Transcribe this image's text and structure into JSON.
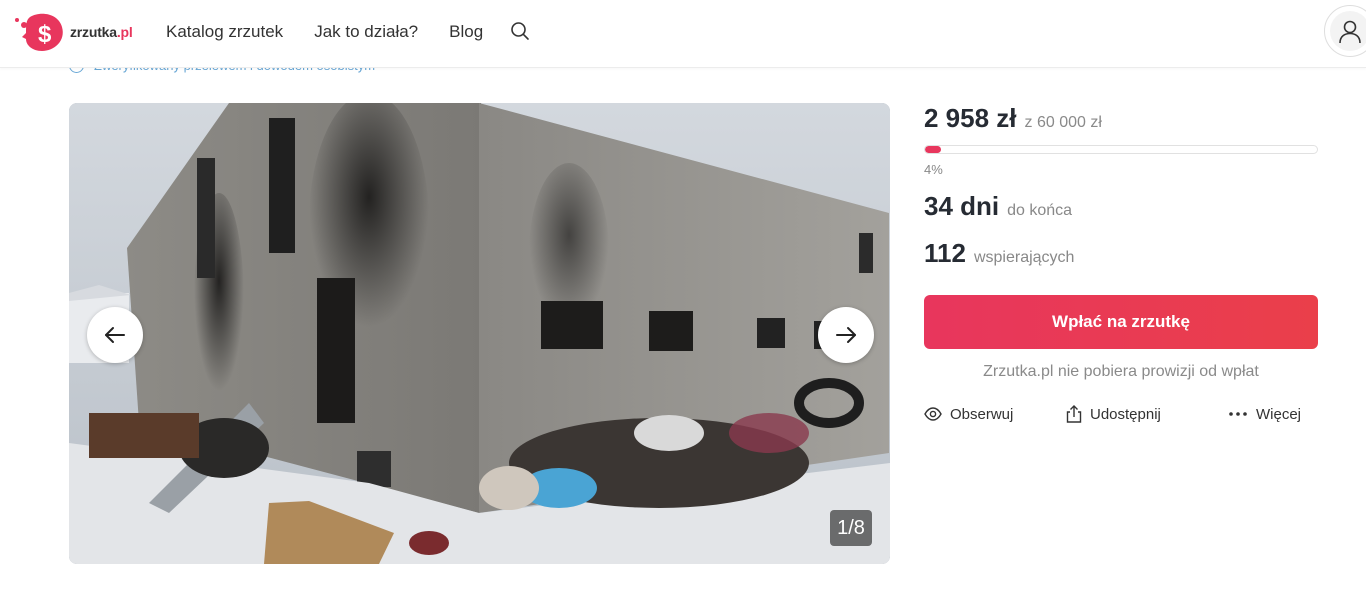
{
  "header": {
    "logo_text": "zrzutka",
    "logo_suffix": ".pl",
    "nav": [
      "Katalog zrzutek",
      "Jak to działa?",
      "Blog"
    ]
  },
  "verified_text": "Zweryfikowany przelewem i dowodem osobistym",
  "gallery": {
    "counter": "1/8",
    "current_index": 1,
    "total": 8
  },
  "funding": {
    "amount": "2 958 zł",
    "goal": "z 60 000 zł",
    "progress_percent": 4,
    "percent_label": "4%",
    "days_value": "34 dni",
    "days_label": "do końca",
    "supporters_value": "112",
    "supporters_label": "wspierających",
    "donate_label": "Wpłać na zrzutkę",
    "no_fee_text": "Zrzutka.pl nie pobiera prowizji od wpłat"
  },
  "actions": {
    "follow": "Obserwuj",
    "share": "Udostępnij",
    "more": "Więcej"
  },
  "colors": {
    "brand": "#e8365d",
    "text_dark": "#262b33",
    "muted": "#8a8a8a"
  }
}
